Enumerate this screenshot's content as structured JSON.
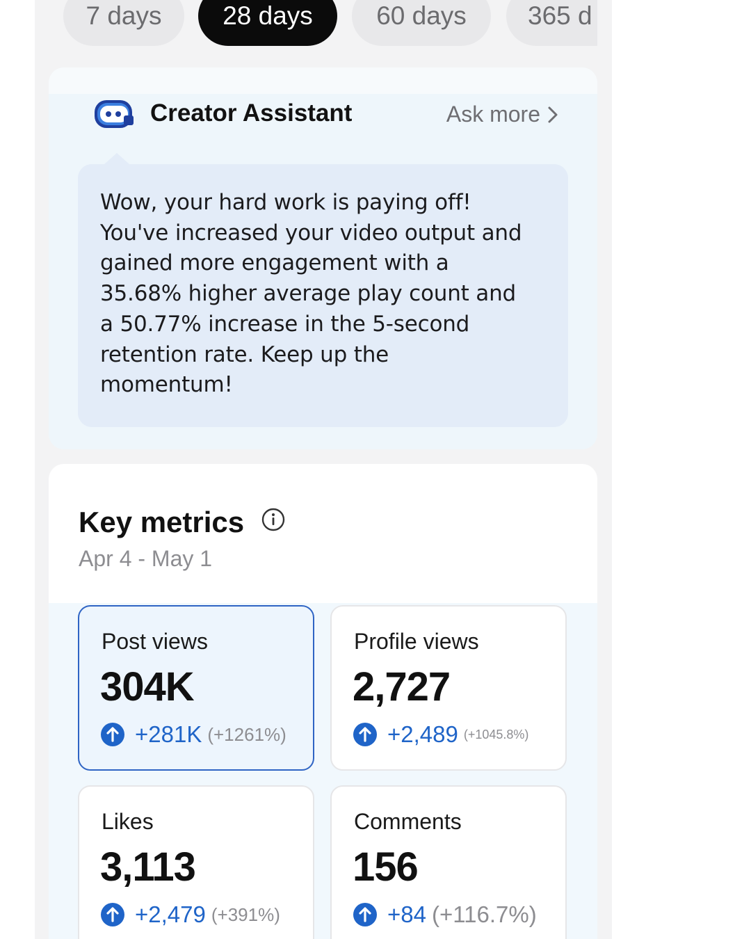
{
  "range_tabs": [
    {
      "label": "7 days",
      "active": false
    },
    {
      "label": "28 days",
      "active": true
    },
    {
      "label": "60 days",
      "active": false
    },
    {
      "label": "365 d",
      "active": false
    }
  ],
  "assistant": {
    "title": "Creator Assistant",
    "ask_more": "Ask more",
    "message_lines": [
      "Wow, your hard work is paying off!",
      "You've increased your video output and",
      "gained more engagement with a",
      "35.68% higher average play count and",
      "a 50.77% increase in the 5-second",
      "retention rate. Keep up the",
      "momentum!"
    ]
  },
  "metrics": {
    "title": "Key metrics",
    "date_range": "Apr 4 - May 1",
    "tiles": [
      {
        "label": "Post views",
        "value": "304K",
        "delta": "+281K",
        "delta_pct": "(+1261%)",
        "selected": true
      },
      {
        "label": "Profile views",
        "value": "2,727",
        "delta": "+2,489",
        "delta_pct": "(+1045.8%)",
        "selected": false
      },
      {
        "label": "Likes",
        "value": "3,113",
        "delta": "+2,479",
        "delta_pct": "(+391%)",
        "selected": false
      },
      {
        "label": "Comments",
        "value": "156",
        "delta": "+84",
        "delta_pct": "(+116.7%)",
        "selected": false
      }
    ]
  },
  "colors": {
    "accent_blue": "#1f64c8",
    "active_pill": "#0b0b0b",
    "selected_border": "#2f64c4"
  }
}
